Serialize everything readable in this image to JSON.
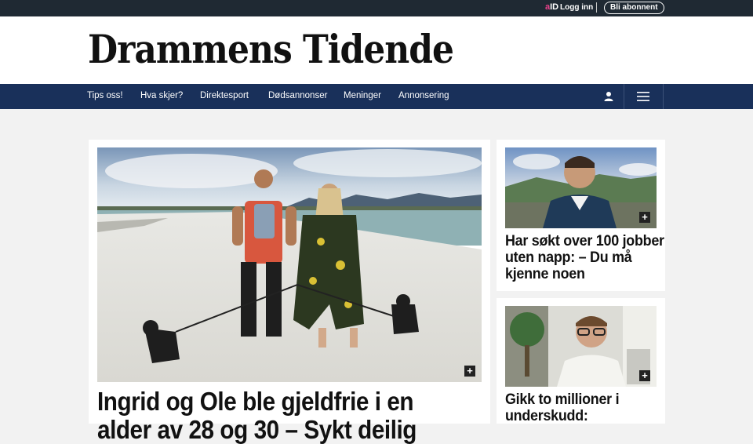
{
  "topbar": {
    "aid_prefix": "a",
    "aid_suffix": "ID",
    "login_label": "Logg inn",
    "subscribe_label": "Bli abonnent"
  },
  "brand": {
    "name": "Drammens Tidende"
  },
  "nav": {
    "items": [
      "Tips oss!",
      "Hva skjer?",
      "Direktesport",
      "Dødsannonser",
      "Meninger",
      "Annonsering"
    ]
  },
  "articles": {
    "main": {
      "title": "Ingrid og Ole ble gjeldfrie i en alder av 28 og 30 – Sykt deilig",
      "image_alt": "Couple with dogs on a beach"
    },
    "side1": {
      "title": "Har søkt over 100 jobber uten napp: – Du må kjenne noen",
      "image_alt": "Young man outdoors"
    },
    "side2": {
      "title": "Gikk to millioner i underskudd:",
      "image_alt": "Man with glasses in office"
    }
  },
  "colors": {
    "nav_bg": "#19305a",
    "topbar_bg": "#1f2933",
    "aid_accent": "#e8408a"
  }
}
